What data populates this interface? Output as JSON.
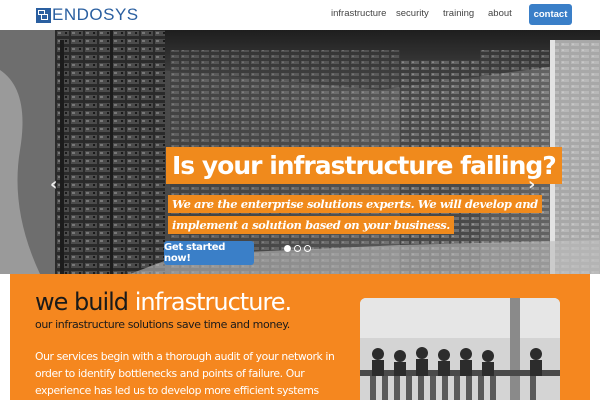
{
  "header": {
    "logo_text": "ENDOSYS",
    "nav": [
      {
        "label": "infrastructure"
      },
      {
        "label": "security"
      },
      {
        "label": "training"
      },
      {
        "label": "about"
      }
    ],
    "contact_label": "contact"
  },
  "hero": {
    "headline": "Is your infrastructure failing?",
    "subtext_line1": "We are the enterprise solutions experts. We will develop and",
    "subtext_line2": "implement a solution based on your business.",
    "cta_label": "Get started now!",
    "slides": 3,
    "active_slide": 1,
    "prev_icon": "chevron-left-icon",
    "next_icon": "chevron-right-icon"
  },
  "section": {
    "heading_dark": "we build",
    "heading_light": "infrastructure.",
    "tagline": "our infrastructure solutions save time and money.",
    "body": "Our services begin with a thorough audit of your network in order to identify bottlenecks and points of failure. Our experience has led us to develop more efficient systems that"
  },
  "colors": {
    "brand_blue": "#3a7fc8",
    "accent_orange": "#f5871f",
    "logo_blue": "#2a5fa0"
  }
}
